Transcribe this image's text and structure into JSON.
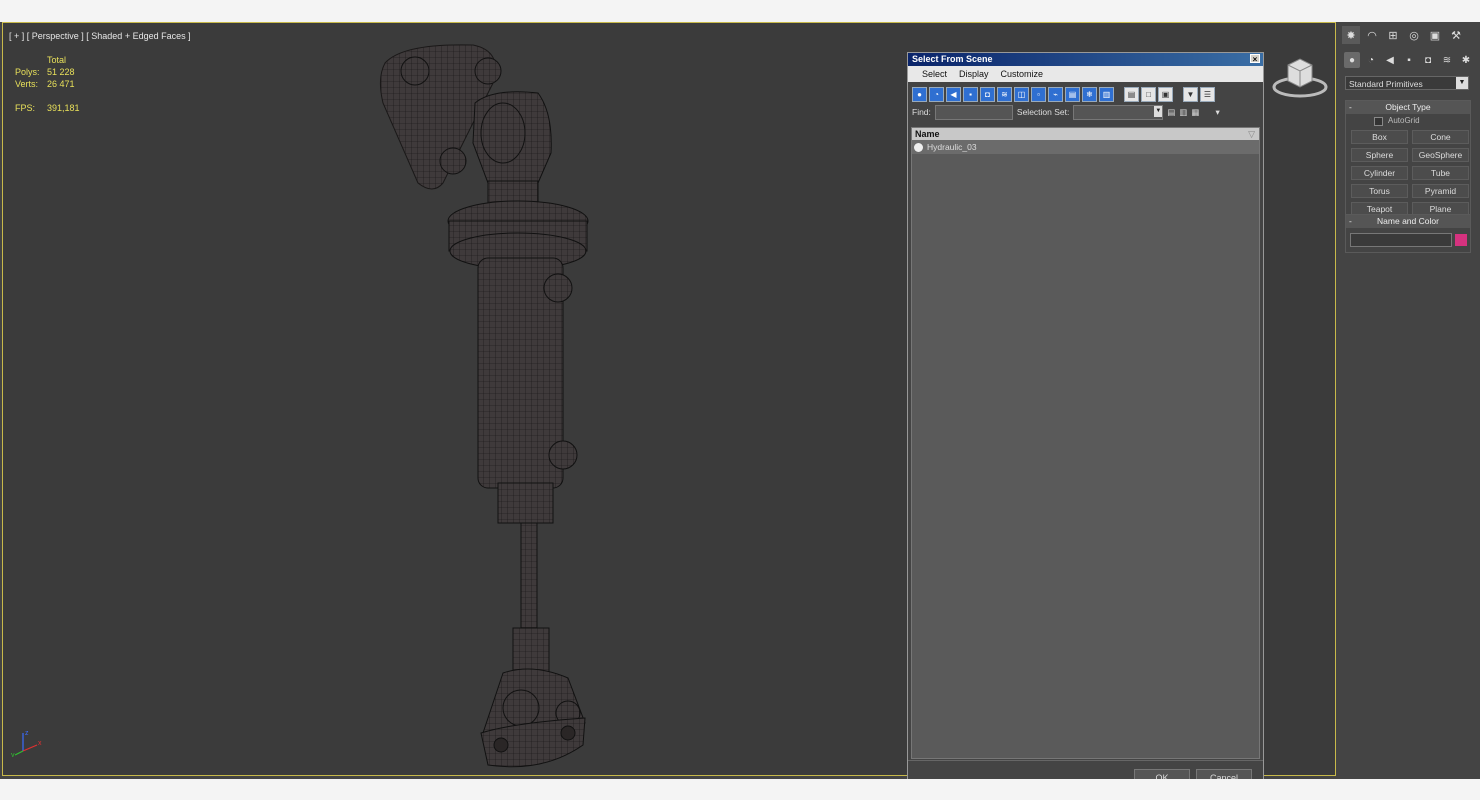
{
  "viewport": {
    "label": "[ + ] [ Perspective ] [ Shaded + Edged Faces ]",
    "stats": {
      "header": "Total",
      "polys_label": "Polys:",
      "polys_value": "51 228",
      "verts_label": "Verts:",
      "verts_value": "26 471",
      "fps_label": "FPS:",
      "fps_value": "391,181"
    },
    "axis": {
      "x": "x",
      "y": "y",
      "z": "z"
    }
  },
  "command_panel": {
    "tabs": [
      "create-icon",
      "modify-icon",
      "hierarchy-icon",
      "motion-icon",
      "display-icon",
      "utilities-icon"
    ],
    "subtabs": [
      "geometry-icon",
      "shapes-icon",
      "lights-icon",
      "cameras-icon",
      "helpers-icon",
      "spacewarps-icon",
      "systems-icon"
    ],
    "category_dropdown": "Standard Primitives",
    "object_type": {
      "title": "Object Type",
      "autogrid": "AutoGrid",
      "buttons": [
        "Box",
        "Cone",
        "Sphere",
        "GeoSphere",
        "Cylinder",
        "Tube",
        "Torus",
        "Pyramid",
        "Teapot",
        "Plane"
      ]
    },
    "name_and_color": {
      "title": "Name and Color",
      "name_value": "",
      "color": "#d6327f"
    }
  },
  "dialog": {
    "title": "Select From Scene",
    "close": "×",
    "menu": [
      "Select",
      "Display",
      "Customize"
    ],
    "find_label": "Find:",
    "find_value": "",
    "selection_set_label": "Selection Set:",
    "selection_set_value": "",
    "column_header": "Name",
    "items": [
      "Hydraulic_03"
    ],
    "ok_label": "OK",
    "cancel_label": "Cancel"
  },
  "colors": {
    "viewport_bg": "#3b3b3b",
    "stats_text": "#e8e05a",
    "active_border": "#c8b94a",
    "title_bar": "#0a246a"
  }
}
